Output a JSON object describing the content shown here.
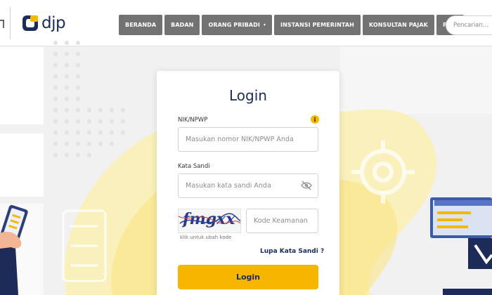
{
  "header": {
    "logo_text": "djp",
    "nav": [
      {
        "label": "BERANDA"
      },
      {
        "label": "BADAN"
      },
      {
        "label": "ORANG PRIBADI",
        "caret": "▾"
      },
      {
        "label": "INSTANSI PEMERINTAH"
      },
      {
        "label": "KONSULTAN PAJAK"
      },
      {
        "label": "PJAP"
      }
    ],
    "search_placeholder": "Pencarian..."
  },
  "login": {
    "title": "Login",
    "npwp_label": "NIK/NPWP",
    "npwp_placeholder": "Masukan nomor NIK/NPWP Anda",
    "password_label": "Kata Sandi",
    "password_placeholder": "Masukan kata sandi Anda",
    "captcha_text": "fmgxx",
    "captcha_hint": "klik untuk ubah kode",
    "security_code_placeholder": "Kode Keamanan",
    "forgot_password": "Lupa Kata Sandi ?",
    "submit_label": "Login"
  },
  "icons": {
    "info": "info-icon",
    "eye": "eye-off-icon"
  },
  "colors": {
    "brand_navy": "#1c2b57",
    "accent_yellow": "#f7b500",
    "nav_gray": "#727272"
  }
}
